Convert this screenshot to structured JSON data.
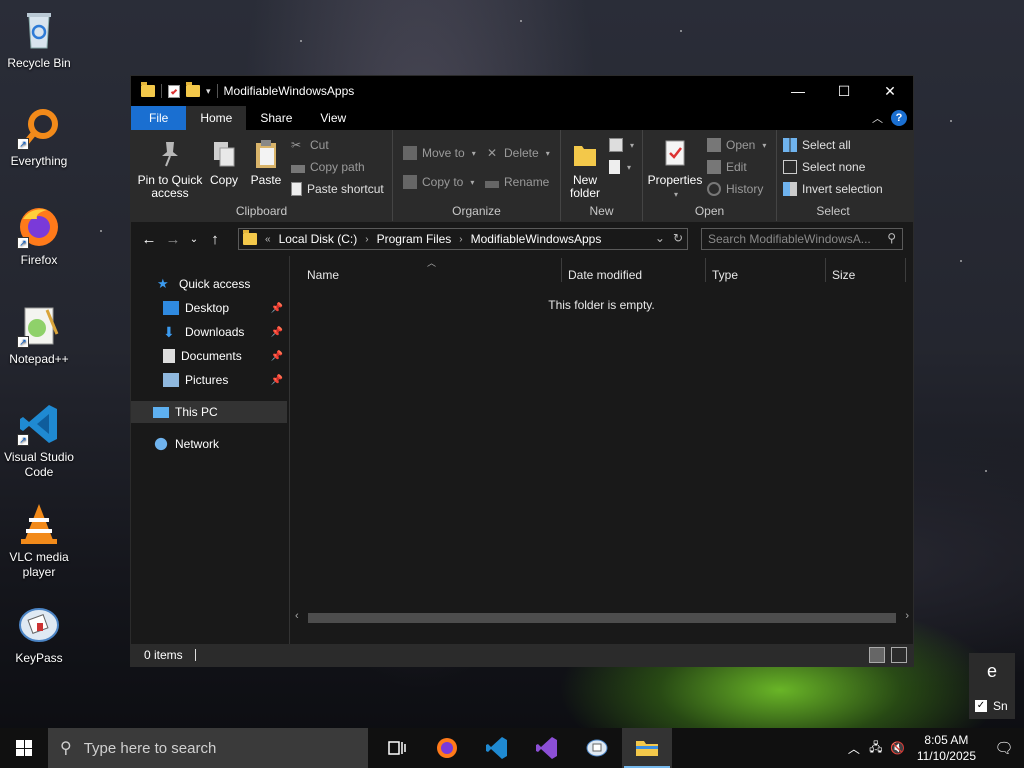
{
  "desktop": {
    "icons": [
      {
        "label": "Recycle Bin",
        "icon": "recycle-bin-icon"
      },
      {
        "label": "Everything",
        "icon": "everything-search-icon"
      },
      {
        "label": "Firefox",
        "icon": "firefox-icon"
      },
      {
        "label": "Notepad++",
        "icon": "notepad-plus-plus-icon"
      },
      {
        "label": "Visual Studio Code",
        "icon": "vscode-icon"
      },
      {
        "label": "VLC media player",
        "icon": "vlc-icon"
      },
      {
        "label": "KeyPass",
        "icon": "keepass-icon"
      }
    ]
  },
  "window": {
    "title": "ModifiableWindowsApps",
    "controls": {
      "minimize": "—",
      "maximize": "☐",
      "close": "✕"
    },
    "tabs": [
      "File",
      "Home",
      "Share",
      "View"
    ],
    "active_tab": "Home",
    "ribbon": {
      "clipboard": {
        "label": "Clipboard",
        "pin": "Pin to Quick access",
        "copy": "Copy",
        "paste": "Paste",
        "cut": "Cut",
        "copy_path": "Copy path",
        "paste_shortcut": "Paste shortcut"
      },
      "organize": {
        "label": "Organize",
        "move_to": "Move to",
        "copy_to": "Copy to",
        "delete": "Delete",
        "rename": "Rename"
      },
      "new": {
        "label": "New",
        "new_folder": "New folder"
      },
      "open": {
        "label": "Open",
        "properties": "Properties",
        "open": "Open",
        "edit": "Edit",
        "history": "History"
      },
      "select": {
        "label": "Select",
        "select_all": "Select all",
        "select_none": "Select none",
        "invert": "Invert selection"
      }
    },
    "address": {
      "prefix": "«",
      "crumbs": [
        "Local Disk (C:)",
        "Program Files",
        "ModifiableWindowsApps"
      ],
      "search_placeholder": "Search ModifiableWindowsA..."
    },
    "nav_pane": {
      "quick_access": "Quick access",
      "items": [
        "Desktop",
        "Downloads",
        "Documents",
        "Pictures"
      ],
      "this_pc": "This PC",
      "network": "Network"
    },
    "columns": [
      "Name",
      "Date modified",
      "Type",
      "Size"
    ],
    "empty_message": "This folder is empty.",
    "status": {
      "count": "0 items"
    }
  },
  "notification": {
    "letter": "e",
    "checkbox_label": "Sn"
  },
  "taskbar": {
    "search_placeholder": "Type here to search",
    "apps": [
      "task-view-icon",
      "firefox-icon",
      "vscode-icon",
      "visual-studio-icon",
      "keepass-icon",
      "file-explorer-icon"
    ],
    "active_app": "file-explorer-icon",
    "time": "8:05 AM",
    "date": "11/10/2025"
  }
}
